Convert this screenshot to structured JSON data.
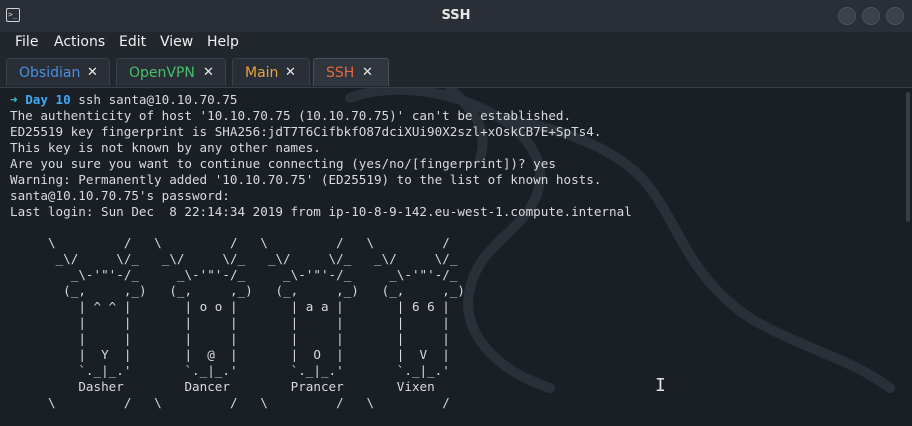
{
  "window": {
    "title": "SSH",
    "app_icon_glyph": ">_"
  },
  "menu": [
    "File",
    "Actions",
    "Edit",
    "View",
    "Help"
  ],
  "tabs": [
    {
      "label": "Obsidian",
      "color": "#4a8fe0",
      "close": "✕",
      "active": false
    },
    {
      "label": "OpenVPN",
      "color": "#45c06a",
      "close": "✕",
      "active": false
    },
    {
      "label": "Main",
      "color": "#e8a33b",
      "close": "✕",
      "active": false
    },
    {
      "label": "SSH",
      "color": "#e8683b",
      "close": "✕",
      "active": true
    }
  ],
  "terminal": {
    "prompt_arrow": "➜",
    "prompt_dir": "Day 10",
    "command": " ssh santa@10.10.70.75",
    "output": [
      "The authenticity of host '10.10.70.75 (10.10.70.75)' can't be established.",
      "ED25519 key fingerprint is SHA256:jdT7T6CifbkfO87dciXUi90X2szl+xOskCB7E+SpTs4.",
      "This key is not known by any other names.",
      "Are you sure you want to continue connecting (yes/no/[fingerprint])? yes",
      "Warning: Permanently added '10.10.70.75' (ED25519) to the list of known hosts.",
      "santa@10.10.70.75's password:",
      "Last login: Sun Dec  8 22:14:34 2019 from ip-10-8-9-142.eu-west-1.compute.internal"
    ],
    "ascii_art": "\\         /   \\         /   \\         /   \\         /\n _\\/     \\/_   _\\/     \\/_   _\\/     \\/_   _\\/     \\/_\n   _\\-'\"'-/_     _\\-'\"'-/_     _\\-'\"'-/_     _\\-'\"'-/_\n  (_,     ,_)   (_,     ,_)   (_,     ,_)   (_,     ,_)\n    | ^ ^ |       | o o |       | a a |       | 6 6 |\n    |     |       |     |       |     |       |     |\n    |     |       |     |       |     |       |     |\n    |  Y  |       |  @  |       |  O  |       |  V  |\n    `._|_.'       `._|_.'       `._|_.'       `._|_.'\n    Dasher        Dancer        Prancer       Vixen\n\\         /   \\         /   \\         /   \\         /",
    "reindeer": [
      "Dasher",
      "Dancer",
      "Prancer",
      "Vixen"
    ]
  },
  "colors": {
    "titlebar": "#2a2e36",
    "terminal_bg": "#1a1f26",
    "accent": "#3fa9f5"
  },
  "icons": [
    "terminal-app-icon",
    "window-buttons",
    "tab-close-icon",
    "text-cursor-icon",
    "kali-dragon-watermark"
  ]
}
